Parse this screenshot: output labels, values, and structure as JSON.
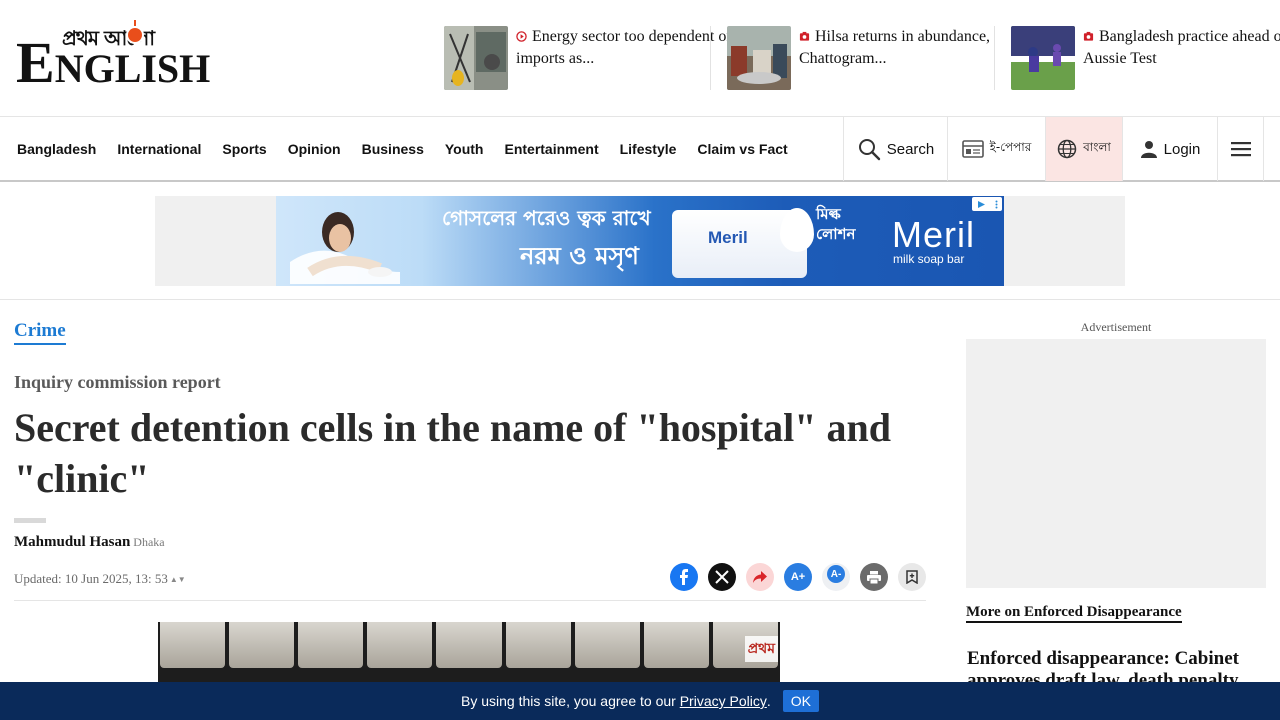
{
  "header": {
    "logo_bn": "প্রথম আলো",
    "logo_en_initial": "E",
    "logo_en_rest": "NGLISH",
    "teasers": [
      {
        "title": "Energy sector too dependent on imports as...",
        "icon": "video-icon"
      },
      {
        "title": "Hilsa returns in abundance, Chattogram...",
        "icon": "photo-icon"
      },
      {
        "title": "Bangladesh practice ahead of Aussie Test",
        "icon": "photo-icon"
      }
    ]
  },
  "nav": {
    "items": [
      "Bangladesh",
      "International",
      "Sports",
      "Opinion",
      "Business",
      "Youth",
      "Entertainment",
      "Lifestyle",
      "Claim vs Fact"
    ],
    "search": "Search",
    "epaper": "ই-পেপার",
    "bangla": "বাংলা",
    "login": "Login"
  },
  "banner_ad": {
    "line1": "গোসলের পরেও ত্বক রাখে",
    "line2": "নরম ও মসৃণ",
    "product_brand": "Meril",
    "product_label": "মিল্ক লোশন",
    "brand": "Meril",
    "subtitle": "milk soap bar"
  },
  "article": {
    "category": "Crime",
    "kicker": "Inquiry commission report",
    "headline": "Secret detention cells in the name of \"hospital\" and \"clinic\"",
    "author": "Mahmudul Hasan",
    "location": "Dhaka",
    "updated": "Updated: 10 Jun 2025, 13: 53",
    "share_actions": [
      "facebook-share",
      "x-share",
      "share",
      "font-increase",
      "font-decrease",
      "print",
      "bookmark"
    ],
    "photo_watermark": "প্রথম"
  },
  "sidebar": {
    "ad_label": "Advertisement",
    "more_link": "More on Enforced Disappearance",
    "story_title": "Enforced disappearance: Cabinet approves draft law, death penalty"
  },
  "cookie": {
    "text": "By using this site, you agree to our",
    "link": "Privacy Policy",
    "period": ".",
    "ok": "OK"
  },
  "colors": {
    "accent_blue": "#1d7bd3",
    "cookie_bg": "#0a2a5a",
    "logo_red": "#e94e1b"
  }
}
